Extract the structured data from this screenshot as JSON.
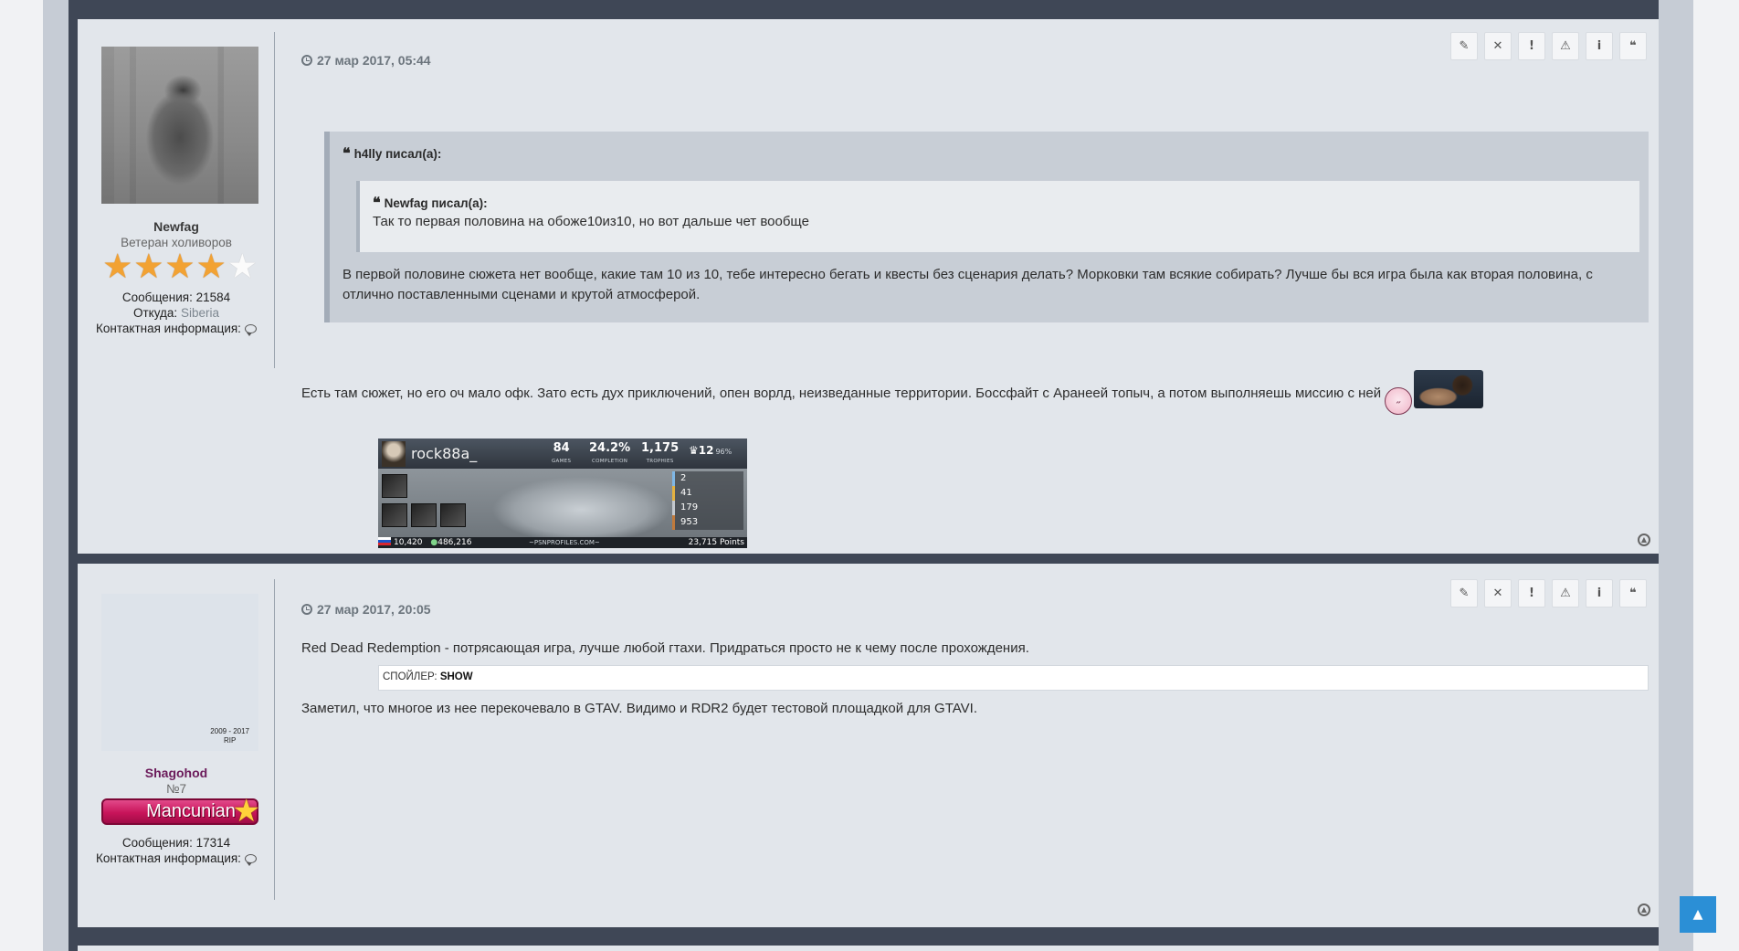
{
  "posts": [
    {
      "author": {
        "name": "Newfag",
        "title": "Ветеран холиворов",
        "rating_stars": 4,
        "rating_max": 5,
        "messages_label": "Сообщения:",
        "messages_value": "21584",
        "from_label": "Откуда:",
        "from_value": "Siberia",
        "contact_label": "Контактная информация:"
      },
      "date": "27 мар 2017, 05:44",
      "quote": {
        "author": "h4lly писал(а):",
        "nested_author": "Newfag писал(а):",
        "nested_text": "Так то первая половина на обоже10из10, но вот дальше чет вообще",
        "text": "В первой половине сюжета нет вообще, какие там 10 из 10, тебе интересно бегать и квесты без сценария делать? Морковки там всякие собирать? Лучше бы вся игра была как вторая половина, с отлично поставленными сценами и крутой атмосферой."
      },
      "text": "Есть там сюжет, но его оч мало офк. Зато есть дух приключений, опен ворлд, неизведанные территории. Боссфайт с Аранеей топыч, а потом выполняешь миссию с ней",
      "signature": {
        "username": "rock88a_",
        "games": "84",
        "games_label": "GAMES",
        "completion": "24.2%",
        "completion_label": "COMPLETION",
        "trophies": "1,175",
        "trophies_label": "TROPHIES",
        "level": "12",
        "level_pct": "96%",
        "platinum": "2",
        "gold": "41",
        "silver": "179",
        "bronze": "953",
        "rank": "10,420",
        "world_rank": "486,216",
        "site": "~PSNPROFILES.COM~",
        "points": "23,715 Points"
      }
    },
    {
      "author": {
        "name": "Shagohod",
        "title": "№7",
        "rip_years": "2009 - 2017",
        "rip": "RIP",
        "badge": "Mancunian",
        "messages_label": "Сообщения:",
        "messages_value": "17314",
        "contact_label": "Контактная информация:"
      },
      "date": "27 мар 2017, 20:05",
      "text": "Red Dead Redemption - потрясающая игра, лучше любой гтахи. Придраться просто не к чему после прохождения.",
      "spoiler_label": "СПОЙЛЕР:",
      "spoiler_action": "SHOW",
      "text2": "Заметил, что многое из нее перекочевало в GTAV. Видимо и RDR2 будет тестовой площадкой для GTAVI."
    }
  ],
  "toolbar_icons": [
    "edit-icon",
    "delete-icon",
    "report-icon",
    "warn-icon",
    "info-icon",
    "quote-icon"
  ],
  "toolbar_glyphs": [
    "✎",
    "✕",
    "!",
    "⚠",
    "i",
    "❝"
  ],
  "colors": {
    "frame": "#3f4756",
    "post_bg": "#e2e6eb",
    "accent": "#2b8fd6",
    "badge": "#c8145a"
  }
}
